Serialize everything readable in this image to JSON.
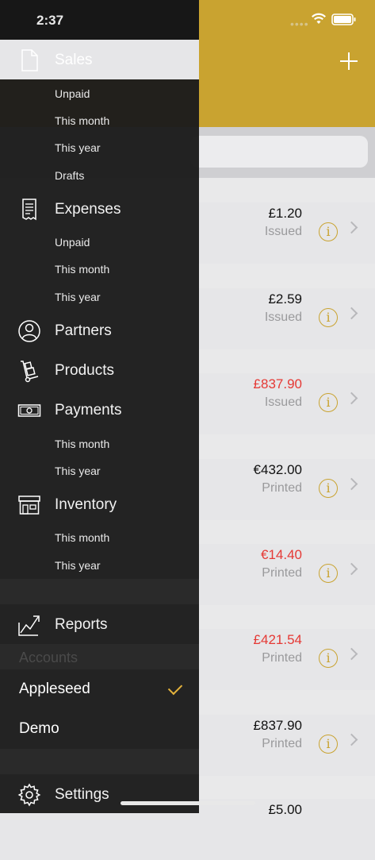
{
  "status_bar": {
    "time": "2:37"
  },
  "drawer": {
    "sales": {
      "label": "Sales",
      "sub": [
        "Unpaid",
        "This month",
        "This year",
        "Drafts"
      ]
    },
    "expenses": {
      "label": "Expenses",
      "sub": [
        "Unpaid",
        "This month",
        "This year"
      ]
    },
    "partners": {
      "label": "Partners"
    },
    "products": {
      "label": "Products"
    },
    "payments": {
      "label": "Payments",
      "sub": [
        "This month",
        "This year"
      ]
    },
    "inventory": {
      "label": "Inventory",
      "sub": [
        "This month",
        "This year"
      ]
    },
    "reports": {
      "label": "Reports"
    },
    "accounts": {
      "header": "Accounts",
      "items": [
        "Appleseed",
        "Demo"
      ]
    },
    "settings": {
      "label": "Settings"
    }
  },
  "list": {
    "rows": [
      {
        "amount": "£1.20",
        "status": "Issued"
      },
      {
        "amount": "£2.59",
        "status": "Issued"
      },
      {
        "amount": "£837.90",
        "status": "Issued"
      },
      {
        "amount": "€432.00",
        "status": "Printed"
      },
      {
        "amount": "€14.40",
        "status": "Printed"
      },
      {
        "amount": "£421.54",
        "status": "Printed"
      },
      {
        "amount": "£837.90",
        "status": "Printed"
      },
      {
        "amount": "£5.00",
        "status": ""
      }
    ]
  },
  "colors": {
    "accent": "#c9a330",
    "overdue": "#e53935",
    "check": "#e3b23c"
  }
}
